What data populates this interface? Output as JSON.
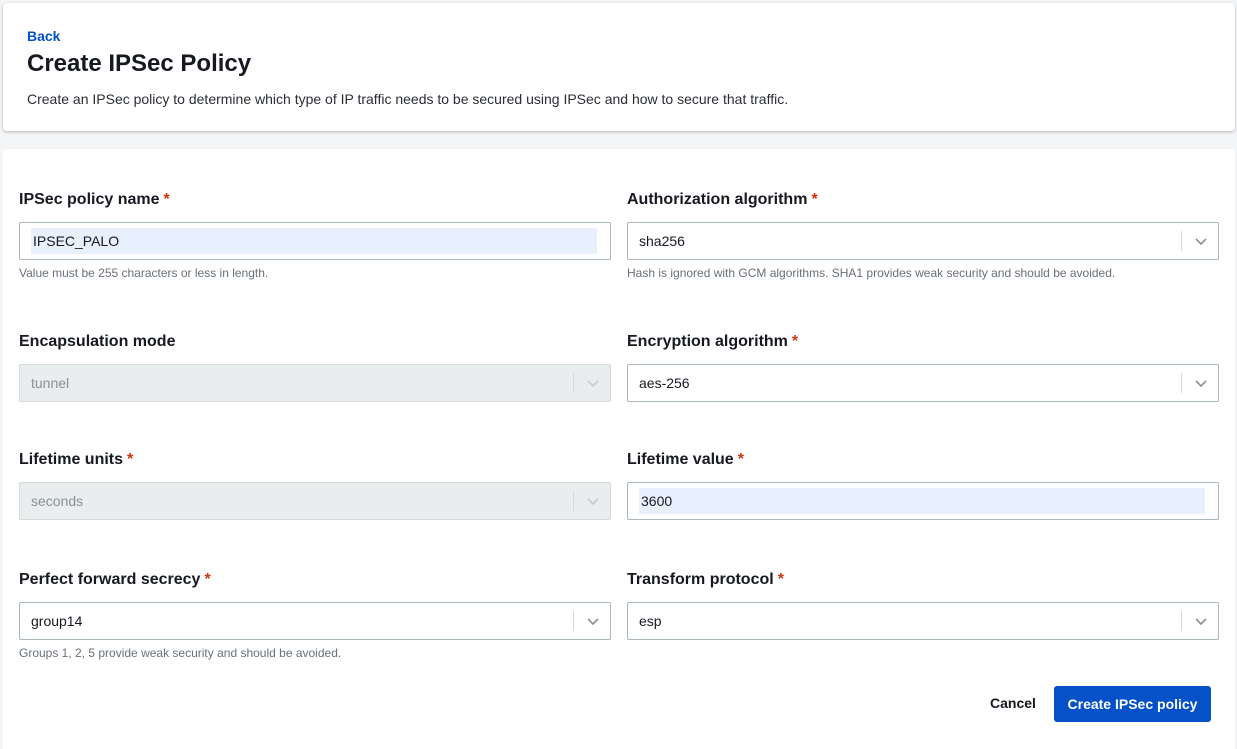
{
  "header": {
    "back_label": "Back",
    "title": "Create IPSec Policy",
    "description": "Create an IPSec policy to determine which type of IP traffic needs to be secured using IPSec and how to secure that traffic."
  },
  "form": {
    "required_marker": "*",
    "policy_name": {
      "label": "IPSec policy name",
      "value": "IPSEC_PALO",
      "hint": "Value must be 255 characters or less in length."
    },
    "authorization_algorithm": {
      "label": "Authorization algorithm",
      "value": "sha256",
      "hint": "Hash is ignored with GCM algorithms. SHA1 provides weak security and should be avoided."
    },
    "encapsulation_mode": {
      "label": "Encapsulation mode",
      "value": "tunnel",
      "disabled": true
    },
    "encryption_algorithm": {
      "label": "Encryption algorithm",
      "value": "aes-256"
    },
    "lifetime_units": {
      "label": "Lifetime units",
      "value": "seconds",
      "disabled": true
    },
    "lifetime_value": {
      "label": "Lifetime value",
      "value": "3600"
    },
    "perfect_forward_secrecy": {
      "label": "Perfect forward secrecy",
      "value": "group14",
      "hint": "Groups 1, 2, 5 provide weak security and should be avoided."
    },
    "transform_protocol": {
      "label": "Transform protocol",
      "value": "esp"
    }
  },
  "actions": {
    "cancel_label": "Cancel",
    "submit_label": "Create IPSec policy"
  },
  "colors": {
    "primary": "#0551c8",
    "link": "#0051c3",
    "required": "#d13212",
    "autofill": "#e8f0fe"
  },
  "icons": {
    "dropdown": "chevron-down-icon"
  }
}
